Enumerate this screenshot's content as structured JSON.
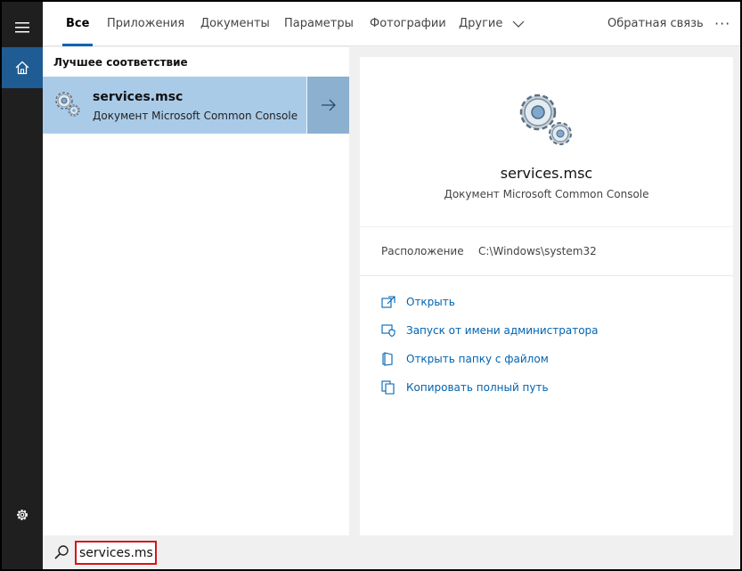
{
  "tabs": [
    {
      "label": "Все",
      "active": true
    },
    {
      "label": "Приложения"
    },
    {
      "label": "Документы"
    },
    {
      "label": "Параметры"
    },
    {
      "label": "Фотографии"
    },
    {
      "label": "Другие"
    }
  ],
  "header": {
    "feedback_label": "Обратная связь",
    "more_label": "···"
  },
  "results": {
    "section_title": "Лучшее соответствие",
    "best_match": {
      "name": "services.msc",
      "type": "Документ Microsoft Common Console",
      "icon": "gears-icon"
    }
  },
  "preview": {
    "name": "services.msc",
    "type": "Документ Microsoft Common Console",
    "location_label": "Расположение",
    "location_value": "C:\\Windows\\system32",
    "actions": [
      {
        "label": "Открыть",
        "icon": "open-icon"
      },
      {
        "label": "Запуск от имени администратора",
        "icon": "shield-icon"
      },
      {
        "label": "Открыть папку с файлом",
        "icon": "folder-icon"
      },
      {
        "label": "Копировать полный путь",
        "icon": "copy-icon"
      }
    ]
  },
  "search": {
    "value": "services.msc"
  },
  "colors": {
    "accent": "#0063b1",
    "selection": "#aacbe8",
    "highlight_border": "#d5151c"
  }
}
